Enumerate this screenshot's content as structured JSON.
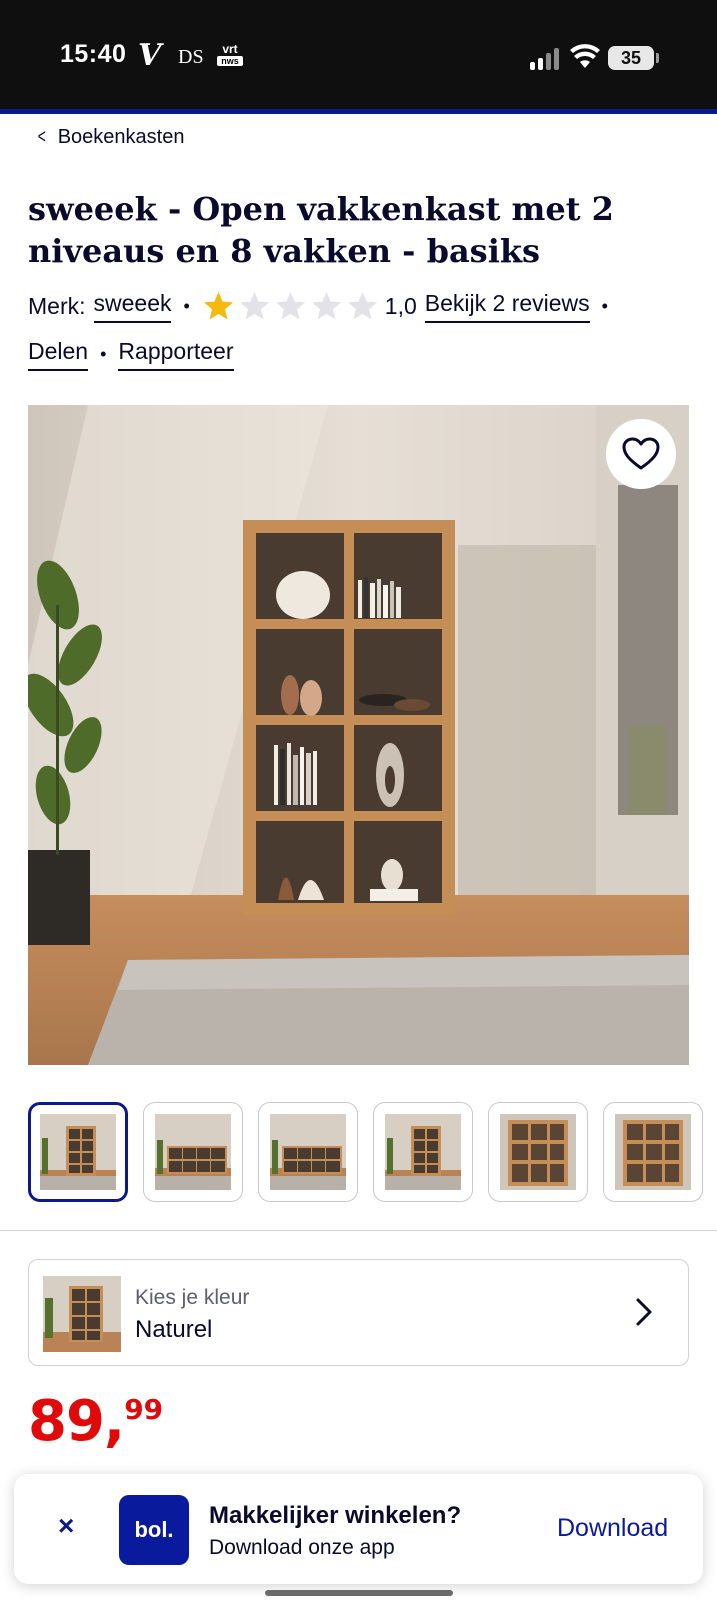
{
  "status_bar": {
    "time": "15:40",
    "app_v": "V",
    "app_ds": "DS",
    "app_vrt_top": "vrt",
    "app_vrt_bottom": "nws",
    "battery": "35"
  },
  "breadcrumb": {
    "label": "Boekenkasten"
  },
  "product": {
    "title": "sweeek - Open vakkenkast met 2 niveaus en 8 vakken - basiks",
    "brand_prefix": "Merk:",
    "brand": "sweeek",
    "rating_value": 1.0,
    "rating_max": 5,
    "rating_text": "1,0",
    "reviews_link": "Bekijk 2 reviews",
    "share_link": "Delen",
    "report_link": "Rapporteer",
    "star_filled_color": "#f5b90f",
    "star_empty_color": "#e2e2e8"
  },
  "gallery": {
    "favorite_icon": "heart-icon",
    "thumbnail_count": 6,
    "active_index": 0
  },
  "color_picker": {
    "label": "Kies je kleur",
    "value": "Naturel"
  },
  "price": {
    "integer": "89,",
    "decimals": "99",
    "color": "#e00a0a"
  },
  "app_banner": {
    "close": "×",
    "logo": "bol.",
    "title": "Makkelijker winkelen?",
    "subtitle": "Download onze app",
    "cta": "Download"
  }
}
